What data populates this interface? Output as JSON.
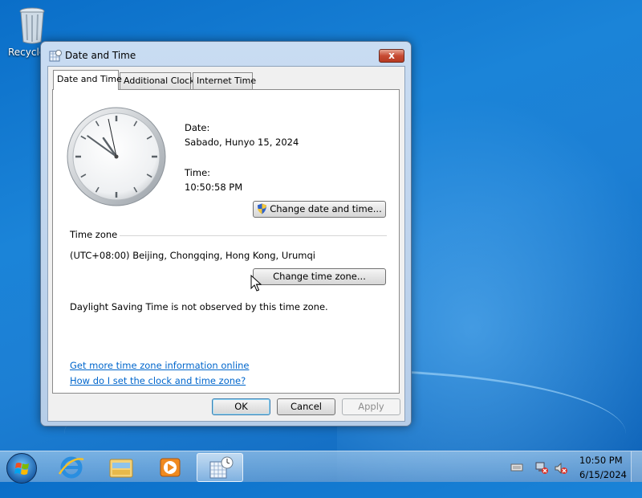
{
  "desktop": {
    "recycle_bin_label": "Recycle"
  },
  "window": {
    "title": "Date and Time",
    "close_label": "x",
    "tabs": [
      {
        "label": "Date and Time",
        "active": true
      },
      {
        "label": "Additional Clocks",
        "active": false
      },
      {
        "label": "Internet Time",
        "active": false
      }
    ],
    "date_label": "Date:",
    "date_value": "Sabado, Hunyo 15, 2024",
    "time_label": "Time:",
    "time_value": "10:50:58 PM",
    "change_datetime_button": "Change date and time...",
    "timezone_heading": "Time zone",
    "timezone_value": "(UTC+08:00) Beijing, Chongqing, Hong Kong, Urumqi",
    "change_timezone_button": "Change time zone...",
    "dst_note": "Daylight Saving Time is not observed by this time zone.",
    "link_more_info": "Get more time zone information online",
    "link_how_to": "How do I set the clock and time zone?",
    "ok_button": "OK",
    "cancel_button": "Cancel",
    "apply_button": "Apply"
  },
  "analog_clock": {
    "hour": 10,
    "minute": 50,
    "second": 58
  },
  "taskbar": {
    "pinned": [
      "internet-explorer-icon",
      "windows-explorer-icon",
      "windows-media-player-icon",
      "date-time-icon"
    ],
    "tray_time": "10:50 PM",
    "tray_date": "6/15/2024"
  },
  "colors": {
    "desktop_blue": "#1b84d8",
    "link_blue": "#0066cc",
    "close_red": "#c74a33"
  }
}
